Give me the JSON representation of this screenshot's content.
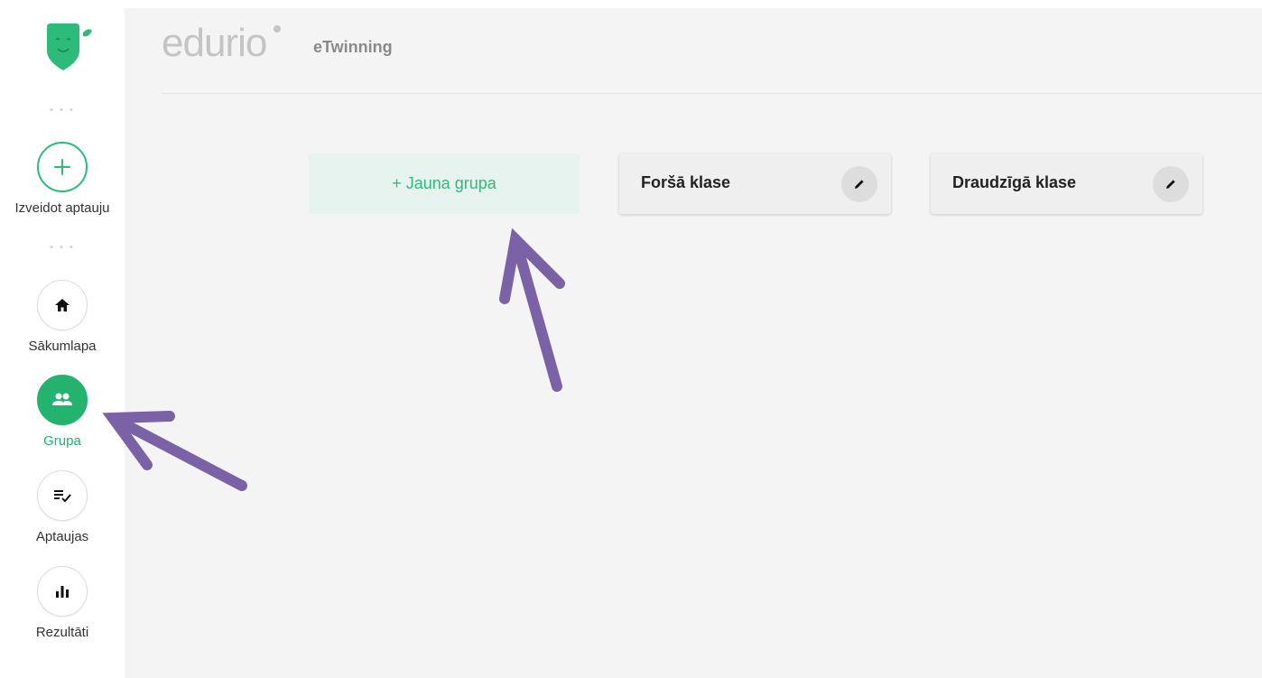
{
  "sidebar": {
    "create": {
      "label": "Izveidot aptauju",
      "icon": "plus-icon"
    },
    "items": [
      {
        "label": "Sākumlapa",
        "icon": "home-icon",
        "active": false
      },
      {
        "label": "Grupa",
        "icon": "group-icon",
        "active": true
      },
      {
        "label": "Aptaujas",
        "icon": "checklist-icon",
        "active": false
      },
      {
        "label": "Rezultāti",
        "icon": "bar-chart-icon",
        "active": false
      }
    ]
  },
  "header": {
    "brand": "edurio",
    "subtitle": "eTwinning"
  },
  "groups": {
    "new_label": "+ Jauna grupa",
    "cards": [
      {
        "name": "Foršā klase"
      },
      {
        "name": "Draudzīgā klase"
      }
    ]
  },
  "colors": {
    "accent": "#24b26f",
    "annotation": "#7b62a6",
    "background": "#f4f4f4"
  }
}
